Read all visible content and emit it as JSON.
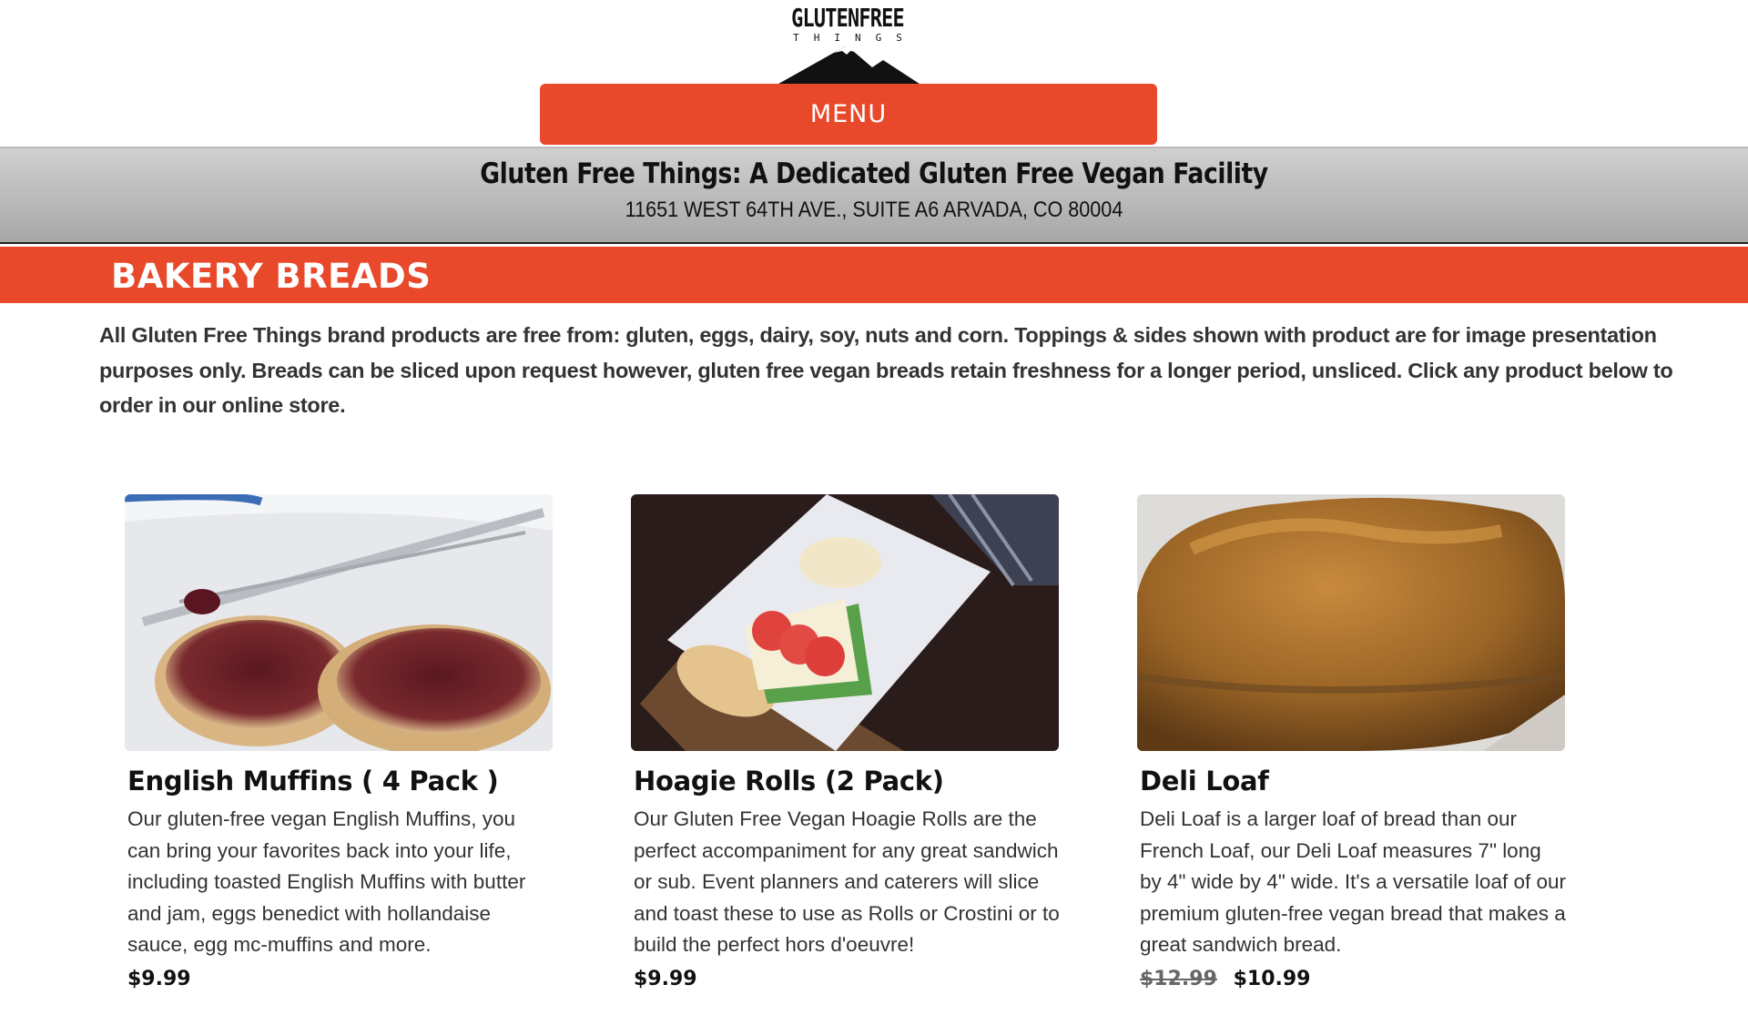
{
  "logo": {
    "word": "GLUTENFREE",
    "sub": "THINGS"
  },
  "menu": {
    "label": "MENU"
  },
  "facility": {
    "title": "Gluten Free Things: A Dedicated Gluten Free Vegan Facility",
    "address": "11651 WEST 64TH AVE., SUITE A6 ARVADA, CO 80004"
  },
  "section": {
    "title": "BAKERY BREADS"
  },
  "intro": "All Gluten Free Things brand products are free from:  gluten, eggs, dairy, soy, nuts and corn. Toppings & sides shown with product are for image presentation purposes only.  Breads can be sliced upon request however, gluten free vegan breads retain freshness for  a longer period, unsliced.  Click any product below to order in our online store.",
  "products": [
    {
      "name": "English Muffins ( 4 Pack )",
      "description": "Our gluten-free vegan English Muffins, you can bring your favorites back into your life, including toasted English Muffins with butter and jam, eggs benedict with hollandaise sauce, egg mc-muffins and more.",
      "price": "$9.99",
      "image": "english-muffins-photo"
    },
    {
      "name": "Hoagie Rolls (2 Pack)",
      "description": "Our Gluten Free Vegan Hoagie Rolls are the perfect accompaniment for any great sandwich or sub. Event planners and caterers will slice and toast these to use as Rolls or Crostini or to build the perfect hors d'oeuvre!",
      "price": "$9.99",
      "image": "hoagie-rolls-photo"
    },
    {
      "name": "Deli Loaf",
      "description": "Deli Loaf is a larger loaf of bread than our French Loaf, our Deli Loaf measures 7\" long by 4\" wide by 4\" wide. It's a versatile loaf of our premium gluten-free vegan bread that makes a great sandwich bread.",
      "old_price": "$12.99",
      "price": "$10.99",
      "image": "deli-loaf-photo"
    }
  ],
  "colors": {
    "accent": "#e8492a",
    "bar_gray": "#b5b5b5",
    "text_dark": "#333333"
  }
}
